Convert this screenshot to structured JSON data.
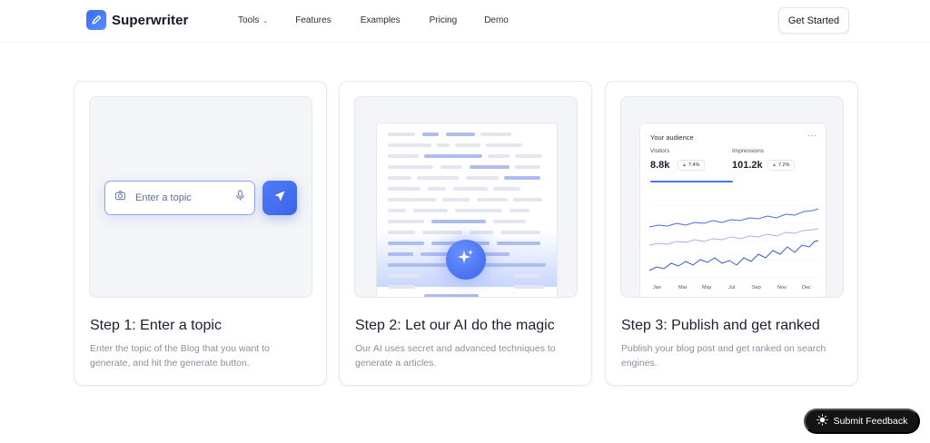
{
  "header": {
    "brand": "Superwriter",
    "nav": [
      {
        "label": "Tools",
        "has_dropdown": true
      },
      {
        "label": "Features"
      },
      {
        "label": "Examples"
      },
      {
        "label": "Pricing"
      },
      {
        "label": "Demo"
      }
    ],
    "cta_label": "Get Started"
  },
  "steps": [
    {
      "title": "Step 1: Enter a topic",
      "description": "Enter the topic of the Blog that you want to generate, and hit the generate button.",
      "input_placeholder": "Enter a topic"
    },
    {
      "title": "Step 2: Let our AI do the magic",
      "description": "Our AI uses secret and advanced techniques to generate a articles."
    },
    {
      "title": "Step 3: Publish and get ranked",
      "description": "Publish your blog post and get ranked on search engines.",
      "panel": {
        "title": "Your audience",
        "more": "···",
        "metrics": [
          {
            "label": "Visitors",
            "value": "8.8k",
            "change": "7.4%"
          },
          {
            "label": "Impressions",
            "value": "101.2k",
            "change": "7.2%"
          }
        ],
        "months": [
          "Jan",
          "Mar",
          "May",
          "Jul",
          "Sep",
          "Nov",
          "Dec"
        ]
      }
    }
  ],
  "feedback_label": "Submit Feedback",
  "colors": {
    "accent": "#3c63e8",
    "accent_light": "#aebdf0",
    "positive": "#1f9d55",
    "dark_button": "#141414"
  }
}
